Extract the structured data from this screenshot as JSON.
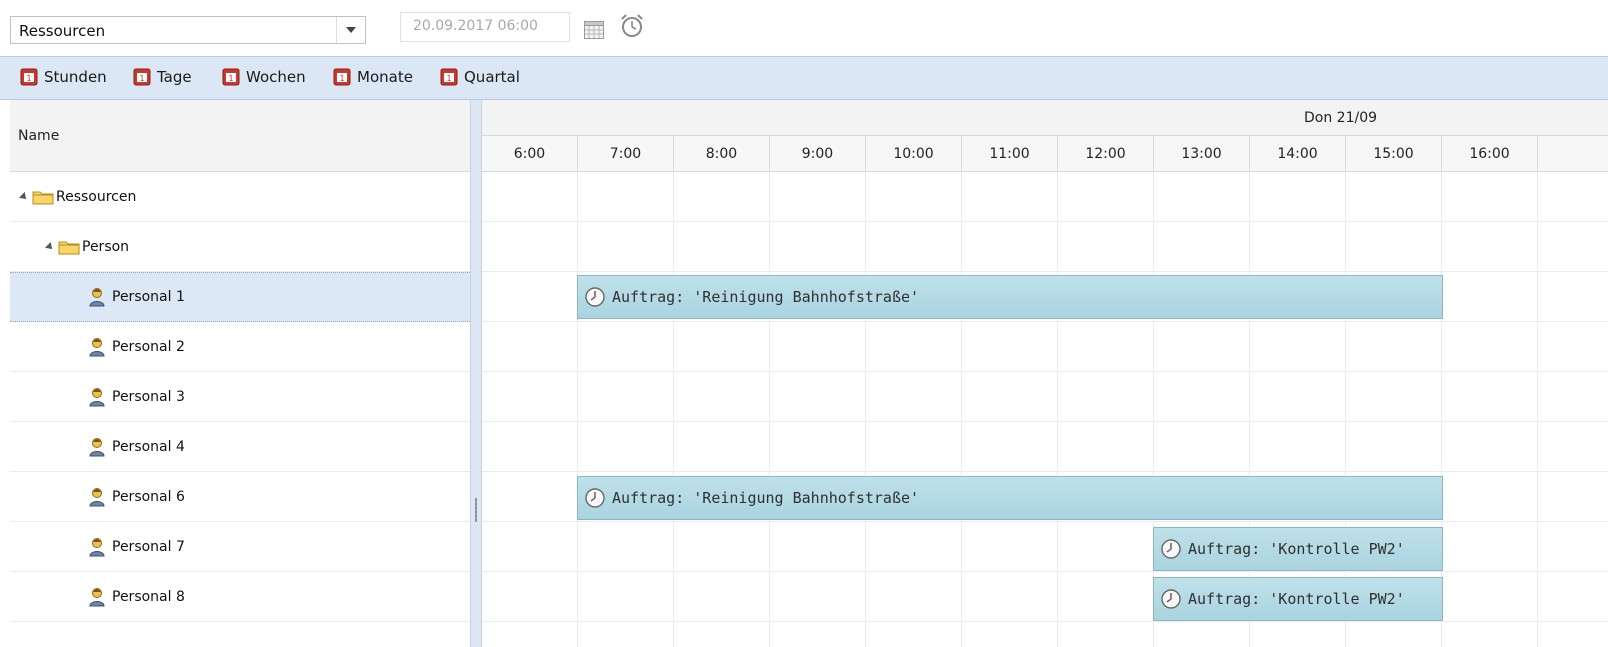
{
  "toolbar": {
    "resource_selector_value": "Ressourcen",
    "date_value": "20.09.2017 06:00"
  },
  "view_buttons": [
    {
      "label": "Stunden",
      "icon": "calendar-icon"
    },
    {
      "label": "Tage",
      "icon": "calendar-icon"
    },
    {
      "label": "Wochen",
      "icon": "calendar-icon"
    },
    {
      "label": "Monate",
      "icon": "calendar-icon"
    },
    {
      "label": "Quartal",
      "icon": "calendar-icon"
    }
  ],
  "resources": {
    "column_header": "Name",
    "rows": [
      {
        "label": "Ressourcen",
        "type": "folder"
      },
      {
        "label": "Person",
        "type": "folder"
      },
      {
        "label": "Personal 1",
        "type": "person",
        "selected": true
      },
      {
        "label": "Personal 2",
        "type": "person"
      },
      {
        "label": "Personal 3",
        "type": "person"
      },
      {
        "label": "Personal 4",
        "type": "person"
      },
      {
        "label": "Personal 6",
        "type": "person"
      },
      {
        "label": "Personal 7",
        "type": "person"
      },
      {
        "label": "Personal 8",
        "type": "person"
      }
    ]
  },
  "timeline": {
    "day_label": "Don 21/09",
    "hours": [
      "6:00",
      "7:00",
      "8:00",
      "9:00",
      "10:00",
      "11:00",
      "12:00",
      "13:00",
      "14:00",
      "15:00",
      "16:00"
    ]
  },
  "appointments": [
    {
      "resource": "Personal 1",
      "text": "Auftrag: 'Reinigung Bahnhofstraße'",
      "start": "7:00",
      "end": "16:00"
    },
    {
      "resource": "Personal 6",
      "text": "Auftrag: 'Reinigung Bahnhofstraße'",
      "start": "7:00",
      "end": "16:00"
    },
    {
      "resource": "Personal 7",
      "text": "Auftrag: 'Kontrolle PW2'",
      "start": "13:00",
      "end": "16:00"
    },
    {
      "resource": "Personal 8",
      "text": "Auftrag: 'Kontrolle PW2'",
      "start": "13:00",
      "end": "16:00"
    }
  ],
  "colors": {
    "appointment_fill": "#b3dbe6",
    "appointment_border": "#8bb6c6",
    "viewbar_bg": "#dbe7f5",
    "selection_bg": "#dde8f6"
  }
}
